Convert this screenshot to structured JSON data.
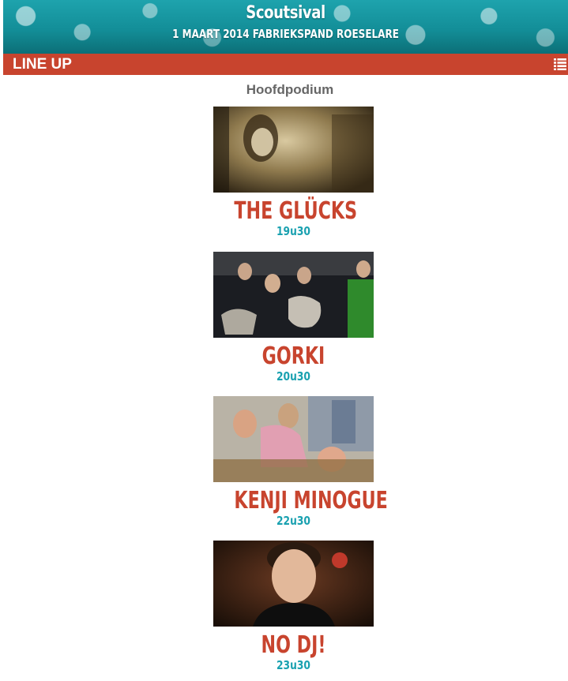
{
  "header": {
    "title": "Scoutsival",
    "subtitle": "1 MAART 2014 FABRIEKSPAND ROESELARE"
  },
  "nav": {
    "title": "LINE UP",
    "menu_icon": "list-menu-icon"
  },
  "section": {
    "title": "Hoofdpodium"
  },
  "acts": [
    {
      "name": "THE GLÜCKS",
      "time": "19u30",
      "photo": "band-photo"
    },
    {
      "name": "GORKI",
      "time": "20u30",
      "photo": "band-photo"
    },
    {
      "name": "KENJI MINOGUE",
      "time": "22u30",
      "photo": "band-photo"
    },
    {
      "name": "NO DJ!",
      "time": "23u30",
      "photo": "artist-photo"
    }
  ],
  "colors": {
    "accent_red": "#c8442e",
    "accent_teal": "#1aa1b0",
    "header_teal": "#138e98",
    "section_gray": "#666666"
  }
}
